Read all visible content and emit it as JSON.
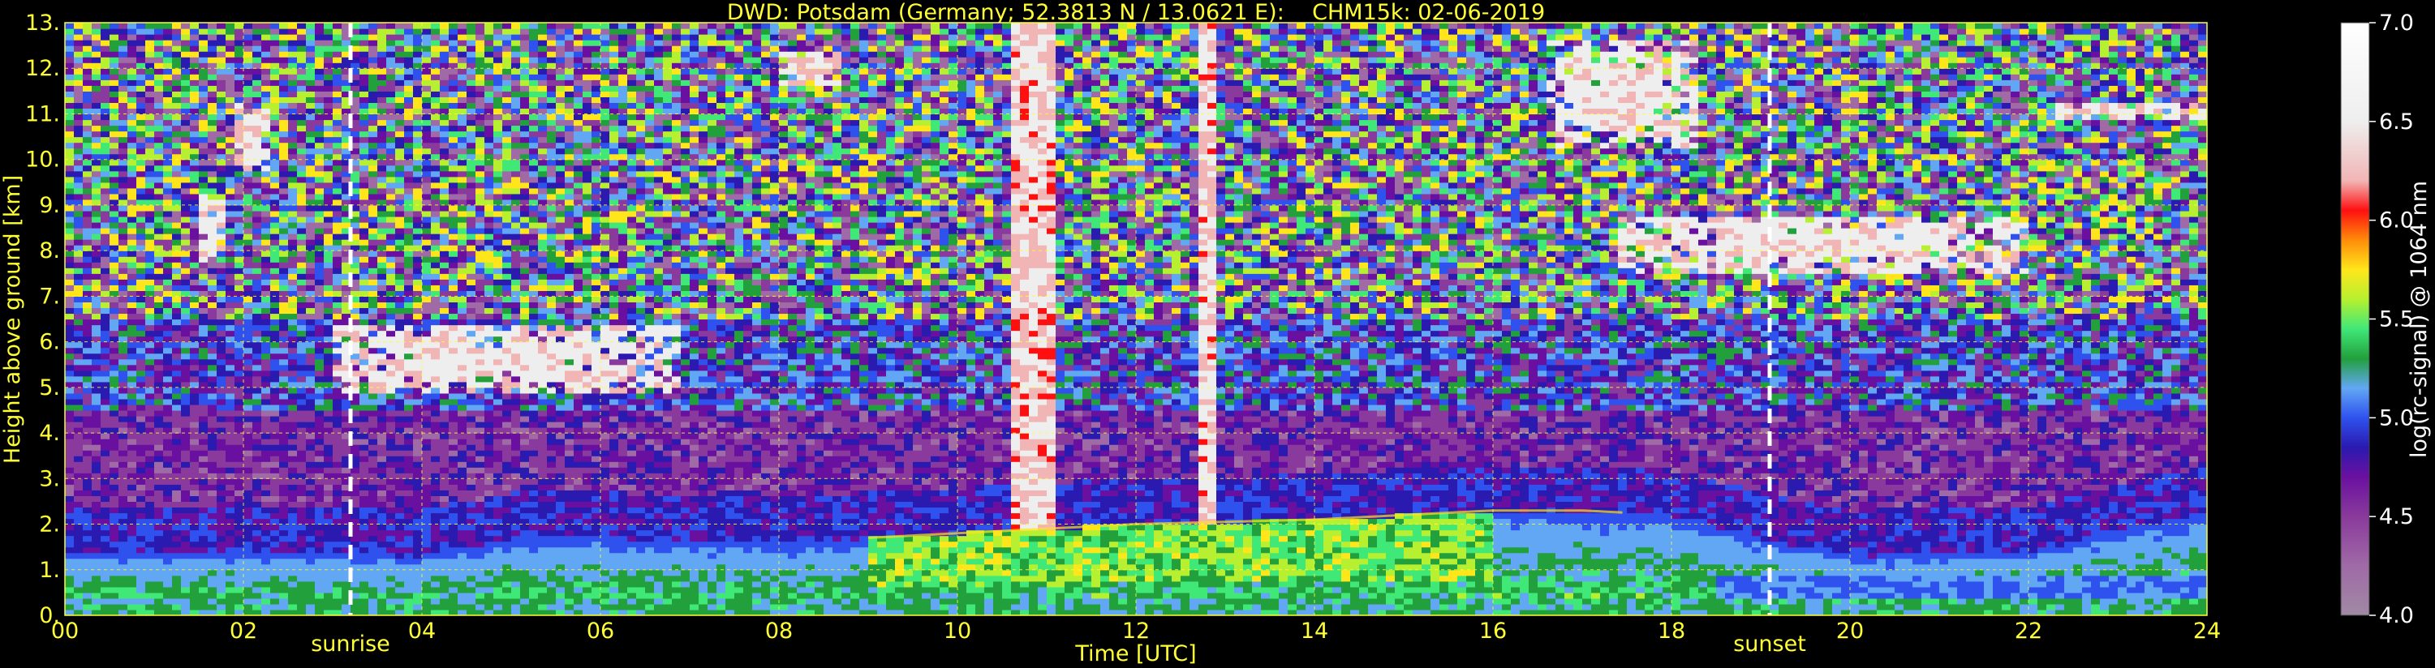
{
  "chart_data": {
    "type": "heatmap",
    "title": "DWD: Potsdam (Germany; 52.3813 N / 13.0621 E):    CHM15k: 02-06-2019",
    "xlabel": "Time [UTC]",
    "ylabel": "Height above ground [km]",
    "x_unit": "hours UTC",
    "xlim": [
      0,
      24
    ],
    "ylim": [
      0,
      13
    ],
    "x_ticks": [
      "00",
      "02",
      "04",
      "06",
      "08",
      "10",
      "12",
      "14",
      "16",
      "18",
      "20",
      "22",
      "24"
    ],
    "y_ticks": [
      "0.",
      "1.",
      "2.",
      "3.",
      "4.",
      "5.",
      "6.",
      "7.",
      "8.",
      "9.",
      "10.",
      "11.",
      "12.",
      "13."
    ],
    "grid": true,
    "colorbar": {
      "label": "log(rc-signal) @ 1064 nm",
      "range": [
        4.0,
        7.0
      ],
      "ticks": [
        "4.0",
        "4.5",
        "5.0",
        "5.5",
        "6.0",
        "6.5",
        "7.0"
      ]
    },
    "markers": [
      {
        "name": "sunrise",
        "x": 3.2
      },
      {
        "name": "sunset",
        "x": 19.1
      }
    ],
    "features": {
      "boundary_layer_top_km": [
        [
          0,
          1.4
        ],
        [
          2,
          1.4
        ],
        [
          4,
          1.3
        ],
        [
          5,
          1.7
        ],
        [
          6,
          1.7
        ],
        [
          8,
          1.6
        ],
        [
          9,
          1.7
        ],
        [
          10,
          1.8
        ],
        [
          11,
          1.9
        ],
        [
          12,
          2.0
        ],
        [
          14,
          2.1
        ],
        [
          15,
          2.2
        ],
        [
          16,
          2.3
        ],
        [
          17,
          2.3
        ],
        [
          18,
          2.2
        ],
        [
          19,
          1.7
        ],
        [
          20,
          1.3
        ],
        [
          22,
          1.4
        ],
        [
          24,
          2.3
        ]
      ],
      "clouds": [
        {
          "x0": 3.0,
          "x1": 6.9,
          "base_km": 4.9,
          "top_km": 6.4
        },
        {
          "x0": 1.5,
          "x1": 1.8,
          "base_km": 7.8,
          "top_km": 9.2
        },
        {
          "x0": 1.9,
          "x1": 2.3,
          "base_km": 9.8,
          "top_km": 11.2
        },
        {
          "x0": 16.6,
          "x1": 18.3,
          "base_km": 10.3,
          "top_km": 12.6
        },
        {
          "x0": 17.4,
          "x1": 22.0,
          "base_km": 7.5,
          "top_km": 8.8
        },
        {
          "x0": 22.3,
          "x1": 24.0,
          "base_km": 10.9,
          "top_km": 11.3
        },
        {
          "x0": 8.0,
          "x1": 8.7,
          "base_km": 11.6,
          "top_km": 12.4
        }
      ],
      "dark_bands_x": [
        10.7,
        10.95,
        12.8
      ]
    },
    "colors": {
      "background": "#000000",
      "text": "#ffff33",
      "colorbar_stops": [
        {
          "v": 4.0,
          "c": "#a08aa4"
        },
        {
          "v": 4.25,
          "c": "#9f6aa6"
        },
        {
          "v": 4.5,
          "c": "#8a3a9c"
        },
        {
          "v": 4.7,
          "c": "#6a10a0"
        },
        {
          "v": 4.85,
          "c": "#2a1ab0"
        },
        {
          "v": 5.0,
          "c": "#2f52ee"
        },
        {
          "v": 5.15,
          "c": "#62a7f4"
        },
        {
          "v": 5.3,
          "c": "#22a03c"
        },
        {
          "v": 5.45,
          "c": "#40e878"
        },
        {
          "v": 5.6,
          "c": "#b6f030"
        },
        {
          "v": 5.75,
          "c": "#ffe61a"
        },
        {
          "v": 5.9,
          "c": "#ff8c0a"
        },
        {
          "v": 6.05,
          "c": "#ff1010"
        },
        {
          "v": 6.2,
          "c": "#f2b5b5"
        },
        {
          "v": 6.5,
          "c": "#eeeeee"
        },
        {
          "v": 7.0,
          "c": "#ffffff"
        }
      ]
    }
  }
}
